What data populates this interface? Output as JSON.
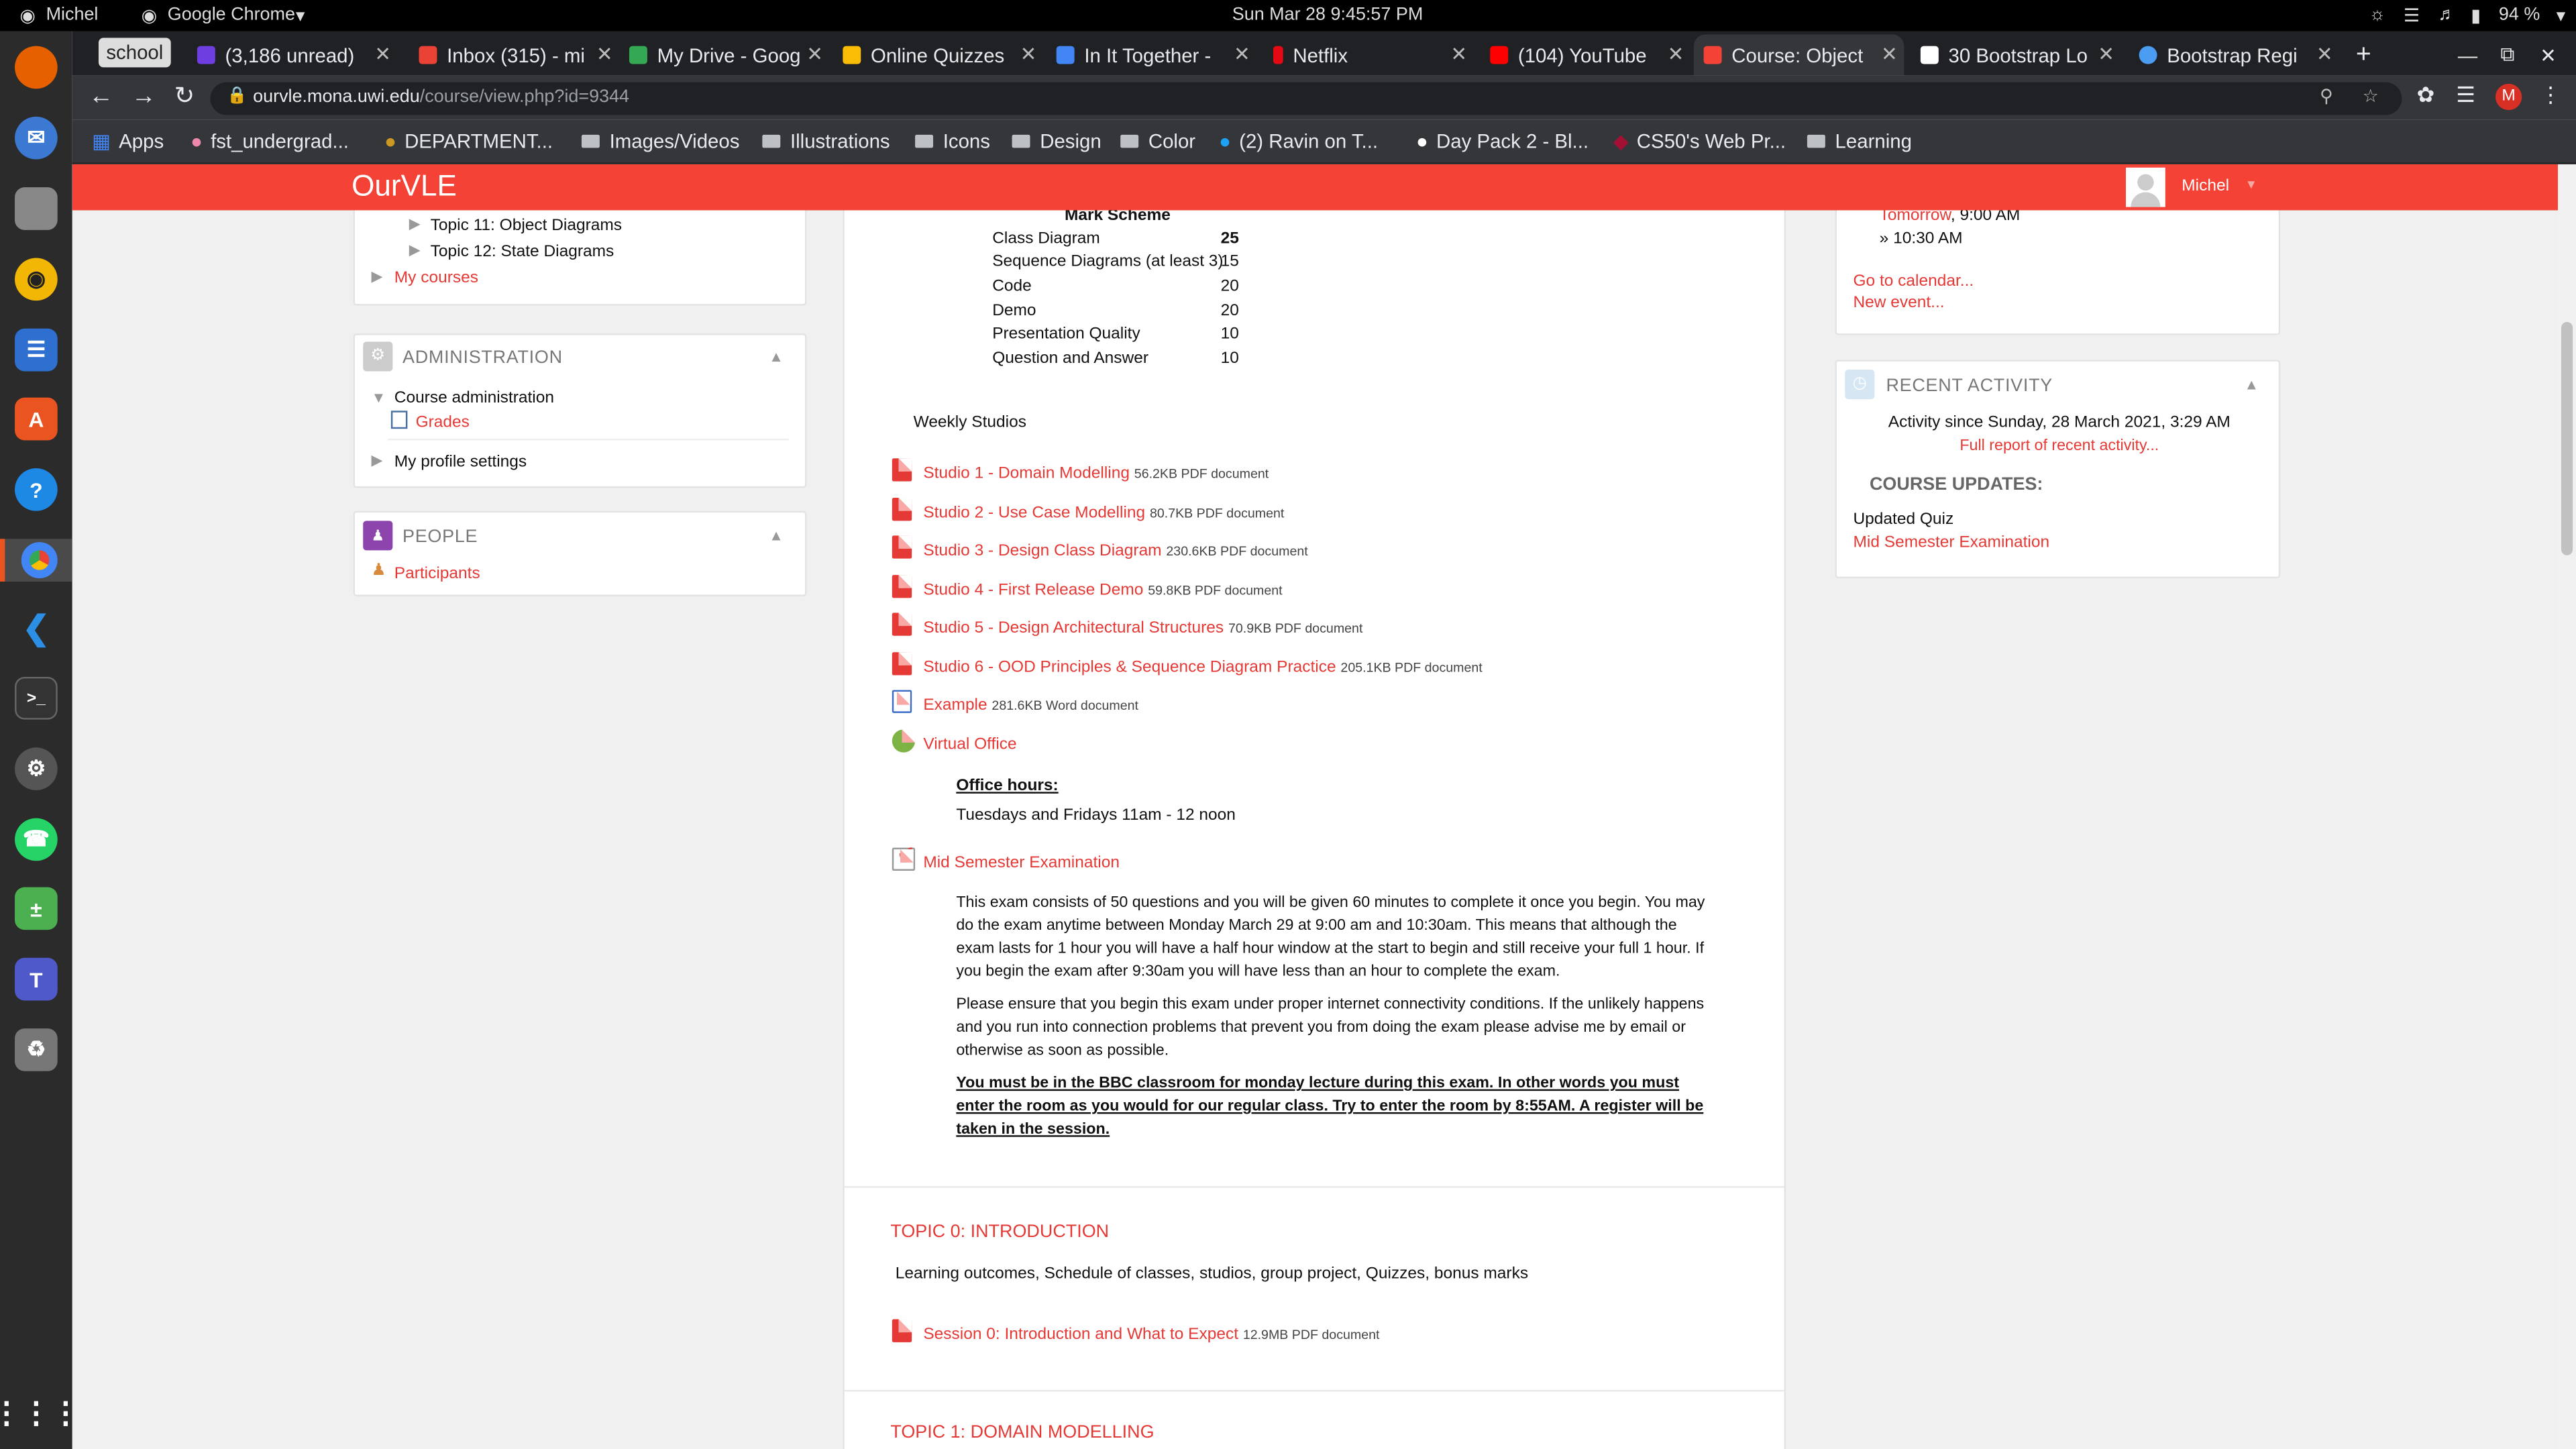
{
  "system": {
    "user": "Michel",
    "app": "Google Chrome",
    "datetime": "Sun Mar 28   9:45:57 PM",
    "battery": "94 %"
  },
  "tabs": [
    {
      "label": "school",
      "color": "#ddd"
    },
    {
      "label": "(3,186 unread)",
      "color": "#6e3ee0"
    },
    {
      "label": "Inbox (315) - mi",
      "color": "#ea4335"
    },
    {
      "label": "My Drive - Goog",
      "color": "#34a853"
    },
    {
      "label": "Online Quizzes",
      "color": "#fbbc05"
    },
    {
      "label": "In It Together -",
      "color": "#4285f4"
    },
    {
      "label": "Netflix",
      "color": "#e50914"
    },
    {
      "label": "(104) YouTube",
      "color": "#ff0000"
    },
    {
      "label": "Course: Object",
      "color": "#f44336"
    },
    {
      "label": "30 Bootstrap Lo",
      "color": "#fff"
    },
    {
      "label": "Bootstrap Regi",
      "color": "#4a9df0"
    }
  ],
  "url": {
    "domain": "ourvle.mona.uwi.edu",
    "path": "/course/view.php?id=9344"
  },
  "bookmarks": [
    {
      "label": "Apps"
    },
    {
      "label": "fst_undergrad..."
    },
    {
      "label": "DEPARTMENT..."
    },
    {
      "label": "Images/Videos"
    },
    {
      "label": "Illustrations"
    },
    {
      "label": "Icons"
    },
    {
      "label": "Design"
    },
    {
      "label": "Color"
    },
    {
      "label": "(2) Ravin on T..."
    },
    {
      "label": "Day Pack 2 - Bl..."
    },
    {
      "label": "CS50's Web Pr..."
    },
    {
      "label": "Learning"
    }
  ],
  "site": {
    "brand": "OurVLE",
    "user": "Michel"
  },
  "left": {
    "nav_items": [
      "Topic 11: Object Diagrams",
      "Topic 12: State Diagrams"
    ],
    "my_courses": "My courses",
    "admin_title": "ADMINISTRATION",
    "course_admin": "Course administration",
    "grades": "Grades",
    "profile": "My profile settings",
    "people_title": "PEOPLE",
    "participants": "Participants"
  },
  "mark_scheme": {
    "title": "Mark Scheme",
    "rows": [
      {
        "item": "Class Diagram",
        "mark": "25"
      },
      {
        "item": "Sequence Diagrams (at least 3)",
        "mark": "15"
      },
      {
        "item": "Code",
        "mark": "20"
      },
      {
        "item": "Demo",
        "mark": "20"
      },
      {
        "item": "Presentation Quality",
        "mark": "10"
      },
      {
        "item": "Question and Answer",
        "mark": "10"
      }
    ]
  },
  "weekly_studios": "Weekly Studios",
  "resources": [
    {
      "name": "Studio 1 - Domain Modelling",
      "meta": "56.2KB PDF document"
    },
    {
      "name": "Studio 2 - Use Case Modelling",
      "meta": "80.7KB PDF document"
    },
    {
      "name": "Studio 3 - Design Class Diagram",
      "meta": "230.6KB PDF document"
    },
    {
      "name": "Studio 4 - First Release Demo",
      "meta": "59.8KB PDF document"
    },
    {
      "name": "Studio 5 - Design Architectural Structures",
      "meta": "70.9KB PDF document"
    },
    {
      "name": "Studio 6 - OOD Principles & Sequence Diagram Practice",
      "meta": "205.1KB PDF document"
    },
    {
      "name": "Example",
      "meta": "281.6KB Word document"
    }
  ],
  "virtual_office": "Virtual Office",
  "office_hours_label": "Office hours:",
  "office_hours": "Tuesdays and Fridays 11am - 12 noon",
  "exam": {
    "link": "Mid Semester Examination",
    "p1": "This exam consists of 50 questions and you will be given 60 minutes to complete it once you begin. You may do the exam anytime between Monday March 29 at 9:00 am and 10:30am. This means that although the exam lasts for 1 hour you will have a half hour window at the start to begin and still receive your full 1 hour. If you begin the exam after 9:30am you will have less than an hour to complete the exam.",
    "p2": "Please ensure that you begin this exam under proper internet connectivity conditions. If the unlikely happens and you run into connection problems that prevent you from doing the exam please advise me by email or otherwise as soon as possible.",
    "p3": "You must be in the BBC classroom for monday lecture during this exam. In other words you must enter the room as you would for our regular class.  Try to enter the room by 8:55AM. A register will be taken in the session."
  },
  "topic0": {
    "title": "TOPIC 0: INTRODUCTION",
    "summary": "Learning outcomes, Schedule of classes, studios, group project, Quizzes, bonus marks",
    "resource": "Session 0: Introduction and What to Expect",
    "meta": "12.9MB PDF document"
  },
  "topic1": {
    "title": "TOPIC 1: DOMAIN MODELLING"
  },
  "right": {
    "event_when": "Tomorrow",
    "event_time": ", 9:00 AM",
    "event_end": "» 10:30 AM",
    "calendar": "Go to calendar...",
    "new_event": "New event...",
    "recent_title": "RECENT ACTIVITY",
    "since": "Activity since Sunday, 28 March 2021, 3:29 AM",
    "full_report": "Full report of recent activity...",
    "updates_title": "COURSE UPDATES:",
    "updated": "Updated Quiz",
    "updated_link": "Mid Semester Examination"
  }
}
